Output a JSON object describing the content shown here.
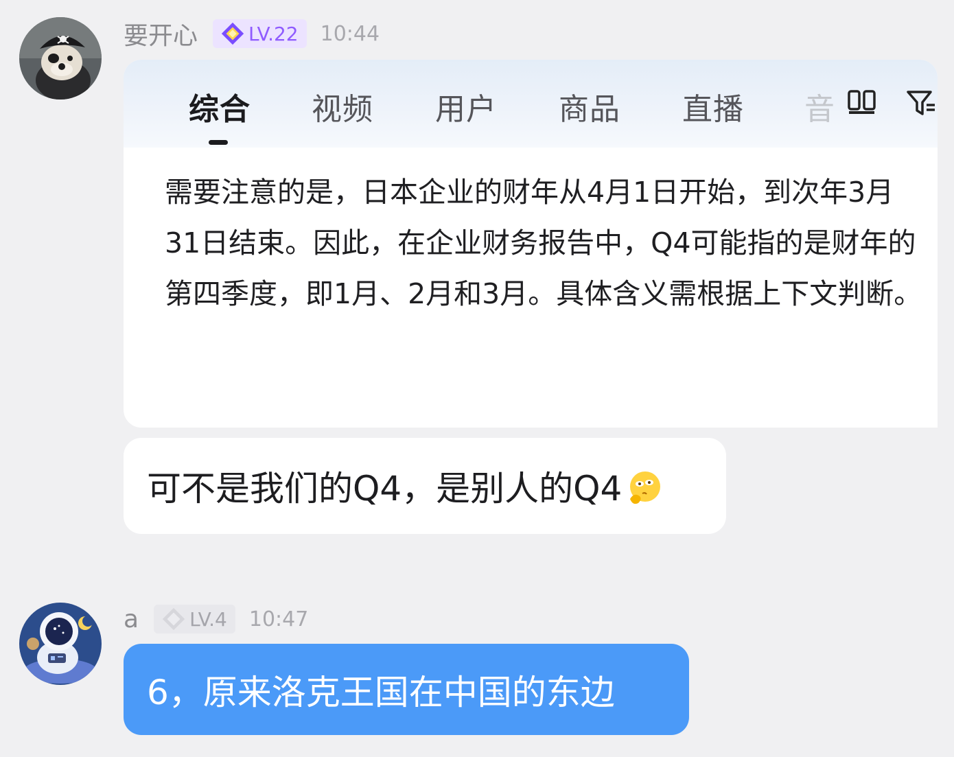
{
  "messages": [
    {
      "user": "要开心",
      "level": "LV.22",
      "time": "10:44",
      "avatar_icon": "pirate-dog-avatar",
      "level_icon": "purple-diamond-level-icon",
      "embedded_screenshot": {
        "tabs": [
          "综合",
          "视频",
          "用户",
          "商品",
          "直播",
          "音"
        ],
        "active_tab": "综合",
        "answer_text": "需要注意的是，日本企业的财年从4月1日开始，到次年3月31日结束。因此，在企业财务报告中，Q4可能指的是财年的第四季度，即1月、2月和3月。具体含义需根据上下文判断。",
        "icons": [
          "grid-icon",
          "filter-icon"
        ]
      },
      "text": "可不是我们的Q4，是别人的Q4",
      "emoji": "thinking-face-emoji"
    },
    {
      "user": "a",
      "level": "LV.4",
      "time": "10:47",
      "avatar_icon": "astronaut-avatar",
      "level_icon": "grey-diamond-level-icon",
      "text": "6，原来洛克王国在中国的东边"
    }
  ],
  "colors": {
    "page_background": "#f0f0f2",
    "own_bubble": "#4b9af8",
    "other_bubble": "#ffffff",
    "level_22_text": "#8f5bff",
    "level_4_text": "#a5a5ab"
  }
}
